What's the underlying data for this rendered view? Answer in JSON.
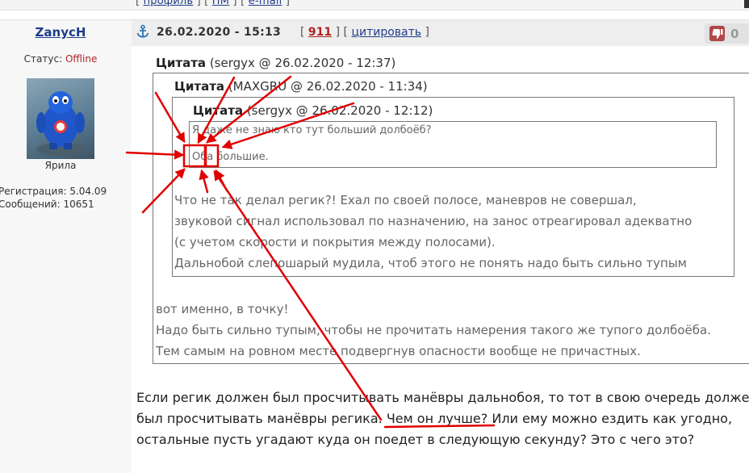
{
  "topbar": {
    "open_bracket": "[ ",
    "profile_link": "профиль",
    "between": " ] [ ",
    "pm_link": "ПМ",
    "email_link": "e-mail",
    "close_bracket": " ]"
  },
  "author": {
    "username": "ZanycH",
    "status_label": "Статус: ",
    "status_value": "Offline",
    "avatar_caption": "Ярила",
    "registration": "Регистрация: 5.04.09",
    "posts": "Сообщений: 10651"
  },
  "post_header": {
    "date": "26.02.2020 - 15:13",
    "bracket_open": "[ ",
    "post_number": "911",
    "bracket_mid": " ] [ ",
    "quote_link": "цитировать",
    "bracket_close": " ]",
    "rating": "0"
  },
  "quote1": {
    "label": "Цитата",
    "meta": " (sergyx @ 26.02.2020 - 12:37)",
    "lines": [
      "вот именно, в точку!",
      "Надо быть сильно тупым, чтобы не прочитать намерения такого же тупого долбоёба.",
      "Тем самым на ровном месте подвергнув опасности вообще не причастных."
    ]
  },
  "quote2": {
    "label": "Цитата",
    "meta": " (MAXGRU @ 26.02.2020 - 11:34)",
    "lines": [
      "Что не так делал регик?! Ехал по своей полосе, маневров не совершал,",
      "звуковой сигнал использовал по назначению, на занос отреагировал адекватно",
      "(с учетом скорости и покрытия между полосами).",
      "Дальнобой слепошарый мудила, чтоб этого не понять надо быть сильно тупым"
    ]
  },
  "quote3": {
    "label": "Цитата",
    "meta": " (sergyx @ 26.02.2020 - 12:12)",
    "line1": "Я даже не знаю кто тут больший долбоёб?",
    "line2": "Оба большие."
  },
  "post_body": {
    "line1": "Если регик должен был просчитывать манёвры дальнобоя, то тот в свою очередь должен",
    "line2_before": "был просчитывать манёвры регика. ",
    "line2_underlined": "Чем он лучше?",
    "line2_after": " Или ему можно ездить как угодно,",
    "line3": "остальные пусть угадают куда он поедет в следующую секунду? Это с чего это?"
  },
  "colors": {
    "annotation": "#e00000",
    "link": "#1e3d8a",
    "offline": "#b22222"
  }
}
